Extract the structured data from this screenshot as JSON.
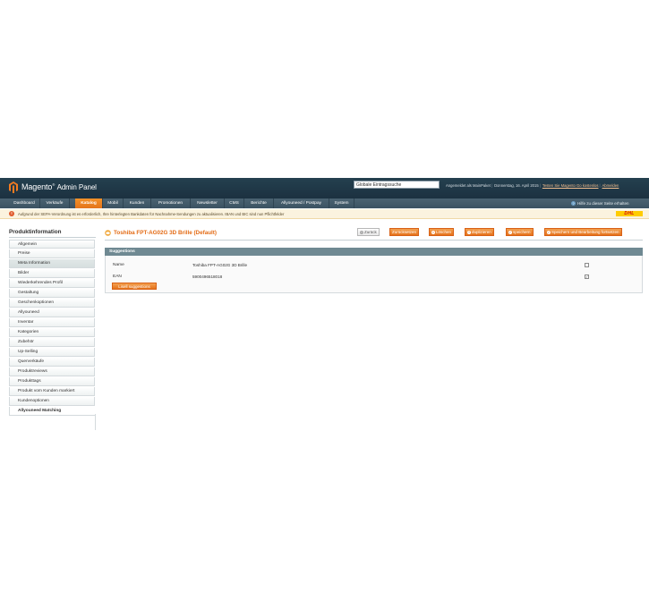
{
  "header": {
    "logo": "Magento",
    "logo_suffix": "Admin Panel",
    "search_value": "Globale Eintragssuche",
    "user_text": "Angemeldet als MainPaket",
    "date_text": "Donnerstag, 16. April 2015",
    "trial_link": "Testen Sie Magento Go kostenlos",
    "logout_link": "Abmelden"
  },
  "nav": {
    "items": [
      "Dashboard",
      "Verkäufe",
      "Katalog",
      "Mobil",
      "Kunden",
      "Promotionen",
      "Newsletter",
      "CMS",
      "Berichte",
      "Allyouneed / Postpay",
      "System"
    ],
    "active": "Katalog",
    "help": "Hilfe zu dieser Seite erhalten"
  },
  "notice": {
    "text": "Aufgrund der SEPA-Verordnung ist es erforderlich, Ihre hinterlegten Bankdaten für Nachnahme-Sendungen zu aktualisieren. IBAN und BIC sind nun Pflichtfelder",
    "logo": "DHL"
  },
  "sidebar": {
    "title": "Produktinformation",
    "items": [
      "Allgemein",
      "Preise",
      "Meta Information",
      "Bilder",
      "Wiederkehrendes Profil",
      "Gestaltung",
      "Geschenkoptionen",
      "Allyouneed",
      "Inventar",
      "Kategorien",
      "Zubehör",
      "Up-Selling",
      "Querverkäufe",
      "Produktreviews",
      "Produkttags",
      "Produkt vom Kunden markiert",
      "Kundenoptionen",
      "Allyouneed Matching"
    ],
    "active": "Allyouneed Matching"
  },
  "page": {
    "title": "Toshiba FPT-AG02G 3D Brille (Default)",
    "buttons": {
      "back": "Zurück",
      "reset": "Zurücksetzen",
      "delete": "Löschen",
      "duplicate": "duplizieren",
      "save": "speichern",
      "save_continue": "Speichern und Bearbeitung fortsetzen"
    }
  },
  "suggestions": {
    "header": "Suggestions",
    "rows": [
      {
        "label": "Name",
        "value": "Toshiba FPT-AG02G 3D Brille",
        "checked": false
      },
      {
        "label": "EAN",
        "value": "5900496518018",
        "checked": true
      }
    ],
    "button": "Lisell suggestions"
  },
  "colors": {
    "accent": "#e5721b",
    "header_bg": "#1c3140",
    "nav_bg": "#3b5362",
    "box_header": "#6f8992"
  }
}
